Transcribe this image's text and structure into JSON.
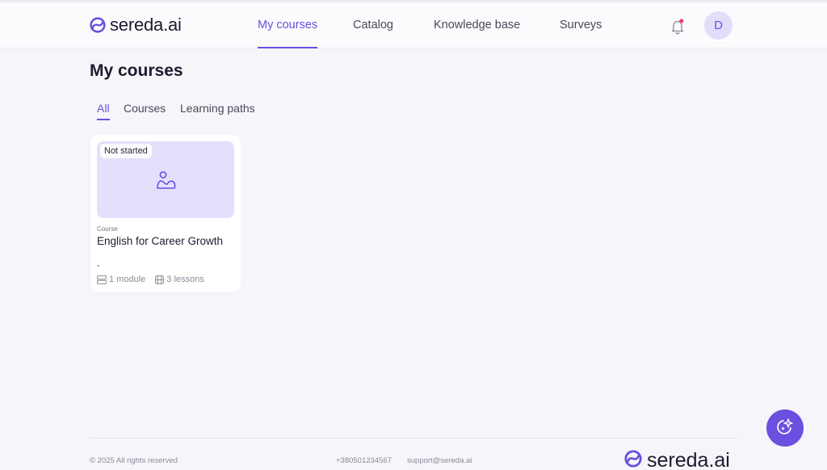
{
  "brand": {
    "name": "sereda.ai",
    "accent": "#6b4fe0"
  },
  "nav": {
    "items": [
      {
        "label": "My courses",
        "active": true
      },
      {
        "label": "Catalog",
        "active": false
      },
      {
        "label": "Knowledge base",
        "active": false
      },
      {
        "label": "Surveys",
        "active": false
      }
    ]
  },
  "header": {
    "notification_icon": "bell-icon",
    "notification_dot_color": "#e8466b",
    "avatar_initial": "D"
  },
  "page": {
    "title": "My courses"
  },
  "tabs": [
    {
      "label": "All",
      "active": true
    },
    {
      "label": "Courses",
      "active": false
    },
    {
      "label": "Learning paths",
      "active": false
    }
  ],
  "courses": [
    {
      "status": "Not started",
      "kind": "Course",
      "title": "English for Career Growth",
      "description": "-",
      "modules": "1 module",
      "lessons": "3 lessons",
      "thumbnail_icon": "image-placeholder-icon"
    }
  ],
  "footer": {
    "copyright": "© 2025 All rights reserved",
    "phone": "+380501234567",
    "email": "support@sereda.ai",
    "logo_text": "sereda.ai"
  },
  "assistant_button": {
    "icon": "ai-sparkle-icon"
  }
}
